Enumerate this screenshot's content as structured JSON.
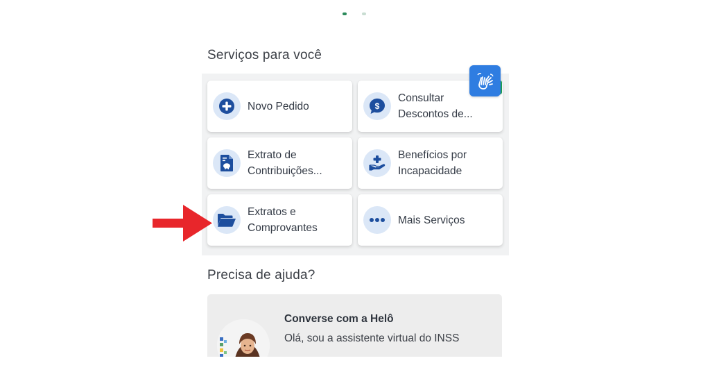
{
  "sections": {
    "services_title": "Serviços para você",
    "help_title": "Precisa de ajuda?"
  },
  "services": [
    {
      "label_lines": [
        "Novo Pedido"
      ],
      "icon": "plus-circle-icon"
    },
    {
      "label_lines": [
        "Consultar",
        "Descontos de..."
      ],
      "icon": "dollar-chat-icon"
    },
    {
      "label_lines": [
        "Extrato de",
        "Contribuições..."
      ],
      "icon": "document-piggy-icon"
    },
    {
      "label_lines": [
        "Benefícios por",
        "Incapacidade"
      ],
      "icon": "hand-plus-icon"
    },
    {
      "label_lines": [
        "Extratos e",
        "Comprovantes"
      ],
      "icon": "folder-open-icon"
    },
    {
      "label_lines": [
        "Mais Serviços"
      ],
      "icon": "more-dots-icon"
    }
  ],
  "help_card": {
    "title": "Converse com a Helô",
    "subtitle": "Olá, sou a assistente virtual do INSS"
  },
  "colors": {
    "accent_blue": "#1d4e9e",
    "icon_bg": "#dbe7f7",
    "libras_button": "#2f7de1",
    "arrow_red": "#e8262b"
  }
}
